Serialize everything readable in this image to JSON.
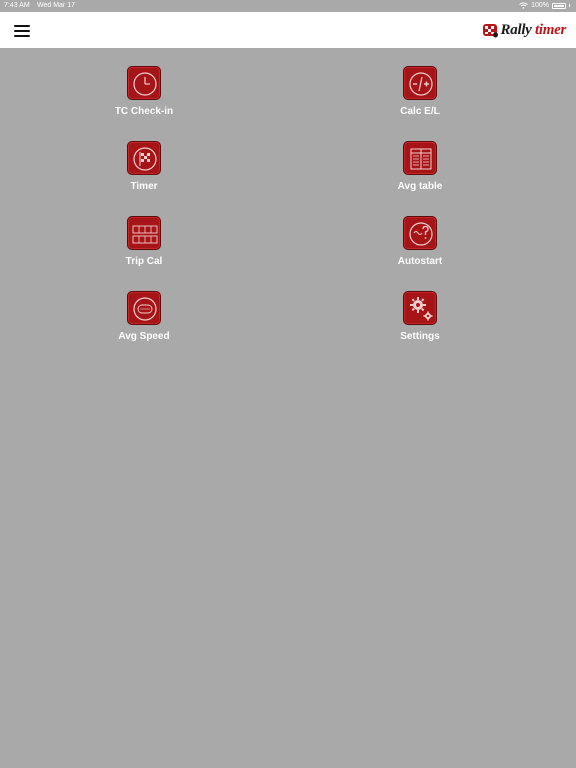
{
  "status_bar": {
    "time": "7:43 AM",
    "date": "Wed Mar 17",
    "battery": "100%"
  },
  "header": {
    "logo_word1": "Rally",
    "logo_word2": "timer"
  },
  "tiles": [
    {
      "label": "TC Check-in",
      "icon": "clock-icon"
    },
    {
      "label": "Calc E/L",
      "icon": "plus-minus-icon"
    },
    {
      "label": "Timer",
      "icon": "checkered-flag-icon"
    },
    {
      "label": "Avg table",
      "icon": "table-icon"
    },
    {
      "label": "Trip Cal",
      "icon": "odometer-icon"
    },
    {
      "label": "Autostart",
      "icon": "autostart-icon"
    },
    {
      "label": "Avg Speed",
      "icon": "speed-icon"
    },
    {
      "label": "Settings",
      "icon": "gear-icon"
    }
  ],
  "colors": {
    "background": "#a9a9a9",
    "tile": "#a71418",
    "header": "#ffffff",
    "brand": "#b8141a"
  }
}
